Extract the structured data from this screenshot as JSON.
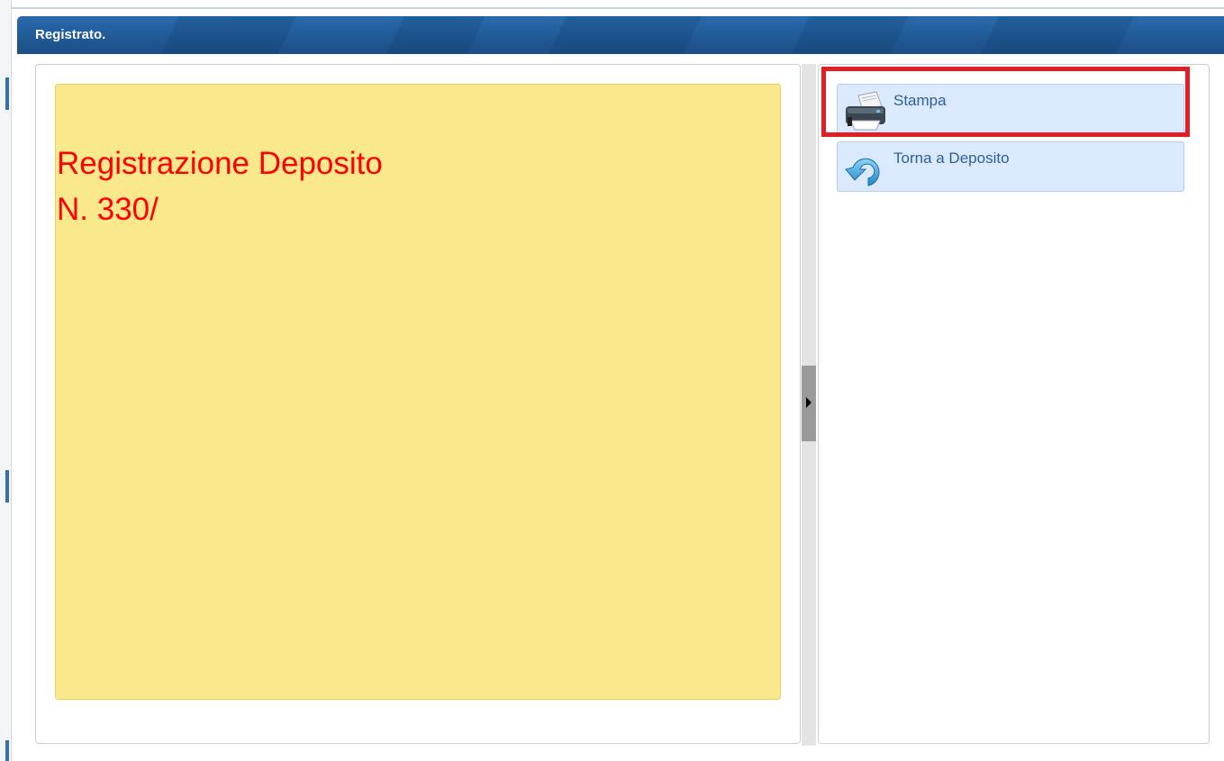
{
  "dialog": {
    "title": "Registrato."
  },
  "notice": {
    "line1": "Registrazione Deposito",
    "line2": "N. 330/",
    "text_color": "#ff0000",
    "background": "#f9e98c"
  },
  "actions": [
    {
      "label": "Stampa",
      "icon": "printer-icon"
    },
    {
      "label": "Torna a Deposito",
      "icon": "back-arrow-icon"
    }
  ],
  "colors": {
    "titlebar": "#205a97",
    "action_button_bg": "#dbe9ff",
    "action_button_text": "#2e5f96",
    "highlight": "#e01e24"
  }
}
